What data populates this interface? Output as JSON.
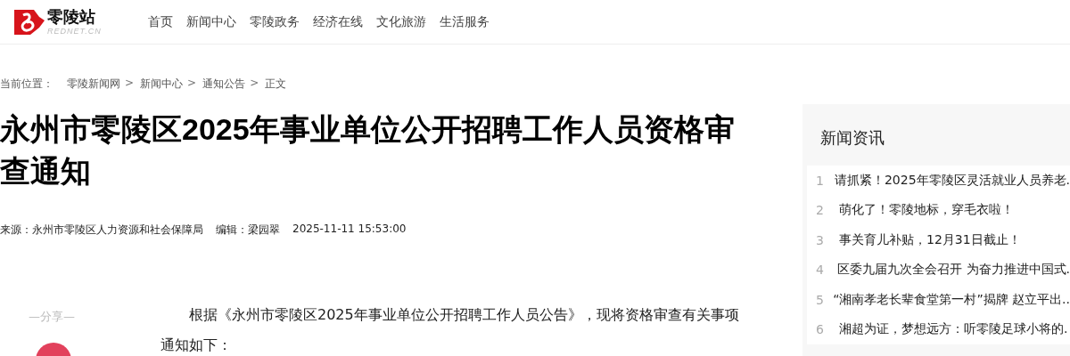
{
  "logo": {
    "name": "零陵站",
    "domain": "REDNET.CN"
  },
  "nav": [
    {
      "label": "首页"
    },
    {
      "label": "新闻中心"
    },
    {
      "label": "零陵政务"
    },
    {
      "label": "经济在线"
    },
    {
      "label": "文化旅游"
    },
    {
      "label": "生活服务"
    }
  ],
  "breadcrumb": {
    "prefix": "当前位置：",
    "items": [
      "零陵新闻网",
      "新闻中心",
      "通知公告",
      "正文"
    ],
    "separator": ">"
  },
  "article": {
    "title": "永州市零陵区2025年事业单位公开招聘工作人员资格审查通知",
    "source": "来源：永州市零陵区人力资源和社会保障局",
    "editor": "编辑：梁园翠",
    "time": "2025-11-11 15:53:00",
    "share_label": "—分享—",
    "paragraphs": [
      "根据《永州市零陵区2025年事业单位公开招聘工作人员公告》，现将资格审查有关事项通知如下："
    ]
  },
  "sidebar": {
    "title": "新闻资讯",
    "items": [
      {
        "rank": "1",
        "text": "请抓紧！2025年零陵区灵活就业人员养老."
      },
      {
        "rank": "2",
        "text": "萌化了！零陵地标，穿毛衣啦！"
      },
      {
        "rank": "3",
        "text": "事关育儿补贴，12月31日截止！"
      },
      {
        "rank": "4",
        "text": "区委九届九次全会召开 为奋力推进中国式."
      },
      {
        "rank": "5",
        "text": "“湘南孝老长辈食堂第一村”揭牌 赵立平出.."
      },
      {
        "rank": "6",
        "text": "湘超为证，梦想远方：听零陵足球小将的."
      }
    ]
  }
}
